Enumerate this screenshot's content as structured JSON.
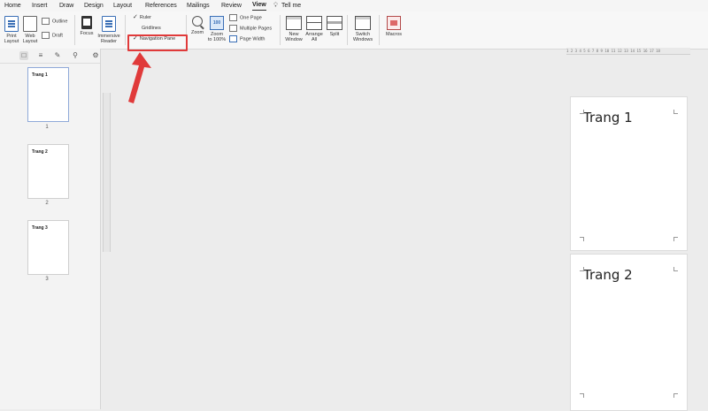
{
  "menu": {
    "tabs": [
      {
        "label": "Home"
      },
      {
        "label": "Insert"
      },
      {
        "label": "Draw"
      },
      {
        "label": "Design"
      },
      {
        "label": "Layout"
      },
      {
        "label": "References"
      },
      {
        "label": "Mailings"
      },
      {
        "label": "Review"
      },
      {
        "label": "View",
        "active": true
      }
    ],
    "tell_me": "Tell me",
    "tell_me_icon": "lightbulb-icon"
  },
  "ribbon": {
    "print_layout": "Print\nLayout",
    "web_layout": "Web\nLayout",
    "outline": "Outline",
    "draft": "Draft",
    "focus": "Focus",
    "immersive_reader": "Immersive\nReader",
    "ruler": "Ruler",
    "ruler_checked": true,
    "gridlines": "Gridlines",
    "gridlines_checked": false,
    "navigation_pane": "Navigation Pane",
    "navigation_pane_checked": true,
    "zoom": "Zoom",
    "zoom_100": "Zoom\nto 100%",
    "one_page": "One Page",
    "multiple_pages": "Multiple Pages",
    "page_width": "Page Width",
    "new_window": "New\nWindow",
    "arrange_all": "Arrange\nAll",
    "split": "Split",
    "switch_windows": "Switch\nWindows",
    "macros": "Macros",
    "highlight_color": "#e03a3a"
  },
  "ruler_h": "1 2 3 4 5 6 7 8 9 10 11 12 13 14 15 16 17 18",
  "sidebar": {
    "tabs": [
      "thumbnails-icon",
      "headings-icon",
      "pages-edit-icon",
      "search-icon",
      "gear-icon"
    ],
    "thumbnails": [
      {
        "title": "Trang 1",
        "number": "1",
        "selected": true
      },
      {
        "title": "Trang 2",
        "number": "2",
        "selected": false
      },
      {
        "title": "Trang 3",
        "number": "3",
        "selected": false
      }
    ]
  },
  "document": {
    "pages": [
      {
        "title": "Trang 1"
      },
      {
        "title": "Trang 2"
      }
    ]
  },
  "colors": {
    "accent_blue": "#3a6fb6",
    "annotation_red": "#e03a3a"
  }
}
